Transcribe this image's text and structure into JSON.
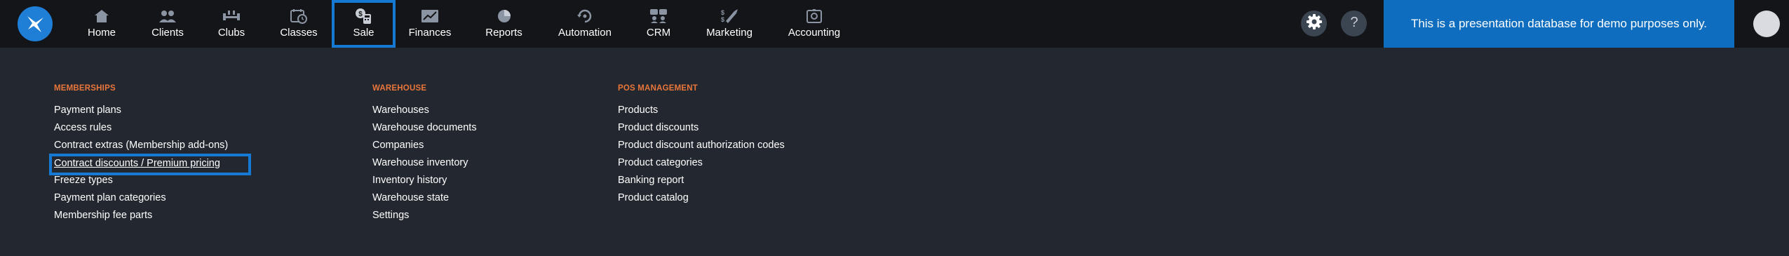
{
  "nav": {
    "items": [
      {
        "label": "Home",
        "icon": "home-icon"
      },
      {
        "label": "Clients",
        "icon": "clients-icon"
      },
      {
        "label": "Clubs",
        "icon": "clubs-icon"
      },
      {
        "label": "Classes",
        "icon": "classes-icon"
      },
      {
        "label": "Sale",
        "icon": "sale-icon",
        "active": true
      },
      {
        "label": "Finances",
        "icon": "finances-icon"
      },
      {
        "label": "Reports",
        "icon": "reports-icon"
      },
      {
        "label": "Automation",
        "icon": "automation-icon"
      },
      {
        "label": "CRM",
        "icon": "crm-icon"
      },
      {
        "label": "Marketing",
        "icon": "marketing-icon"
      },
      {
        "label": "Accounting",
        "icon": "accounting-icon"
      }
    ]
  },
  "banner": {
    "text": "This is a presentation database for demo purposes only."
  },
  "colors": {
    "accent": "#1679d4",
    "heading": "#e9763a",
    "topbar": "#141518",
    "background": "#23272f",
    "banner": "#0f6dbf"
  },
  "menu": {
    "memberships": {
      "heading": "MEMBERSHIPS",
      "links": [
        "Payment plans",
        "Access rules",
        "Contract extras (Membership add-ons)",
        "Contract discounts / Premium pricing",
        "Freeze types",
        "Payment plan categories",
        "Membership fee parts"
      ]
    },
    "warehouse": {
      "heading": "WAREHOUSE",
      "links": [
        "Warehouses",
        "Warehouse documents",
        "Companies",
        "Warehouse inventory",
        "Inventory history",
        "Warehouse state",
        "Settings"
      ]
    },
    "pos": {
      "heading": "POS MANAGEMENT",
      "links": [
        "Products",
        "Product discounts",
        "Product discount authorization codes",
        "Product categories",
        "Banking report",
        "Product catalog"
      ]
    }
  }
}
